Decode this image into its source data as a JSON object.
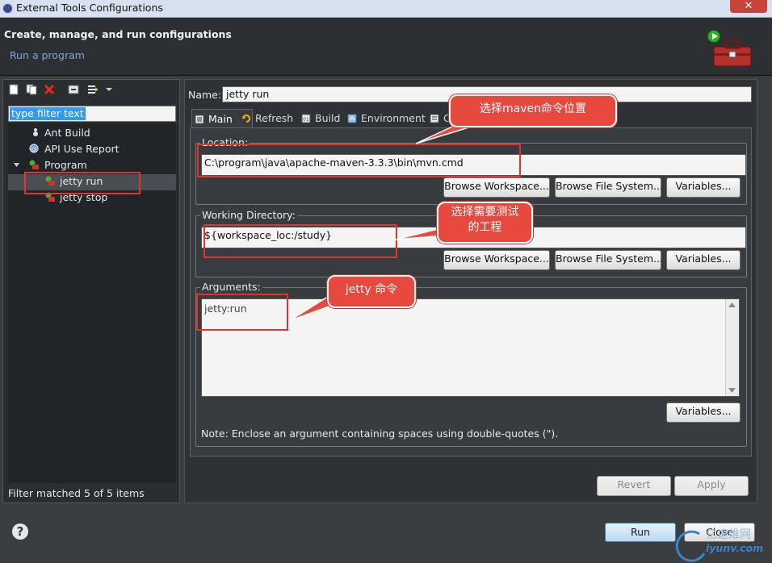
{
  "window": {
    "title": "External Tools Configurations"
  },
  "header": {
    "title": "Create, manage, and run configurations",
    "subtitle": "Run a program"
  },
  "left": {
    "filter_placeholder": "type filter text",
    "tree": [
      {
        "label": "Ant Build"
      },
      {
        "label": "API Use Report"
      },
      {
        "label": "Program"
      },
      {
        "label": "jetty run"
      },
      {
        "label": "jetty stop"
      }
    ],
    "status": "Filter matched 5 of 5 items"
  },
  "main": {
    "name_label": "Name:",
    "name_value": "jetty run",
    "tabs": [
      {
        "label": "Main"
      },
      {
        "label": "Refresh"
      },
      {
        "label": "Build"
      },
      {
        "label": "Environment"
      },
      {
        "label": "C"
      }
    ],
    "location": {
      "label": "Location:",
      "value": "C:\\program\\java\\apache-maven-3.3.3\\bin\\mvn.cmd",
      "buttons": [
        "Browse Workspace...",
        "Browse File System...",
        "Variables..."
      ]
    },
    "working_directory": {
      "label": "Working Directory:",
      "value": "${workspace_loc:/study}",
      "buttons": [
        "Browse Workspace...",
        "Browse File System...",
        "Variables..."
      ]
    },
    "arguments": {
      "label": "Arguments:",
      "value": "jetty:run",
      "button": "Variables...",
      "note": "Note: Enclose an argument containing spaces using double-quotes (\")."
    },
    "revert_label": "Revert",
    "apply_label": "Apply"
  },
  "footer": {
    "run_label": "Run",
    "close_label": "Close"
  },
  "annotations": {
    "callout1": "选择maven命令位置",
    "callout2_line1": "选择需要测试",
    "callout2_line2": "的工程",
    "callout3": "jetty 命令"
  },
  "watermark": {
    "cn": "亿速维网",
    "url": "iyunv.com"
  },
  "colors": {
    "annotation_red": "#e8493f",
    "selection_blue": "#3399ff",
    "header_link": "#7aa6d6"
  }
}
